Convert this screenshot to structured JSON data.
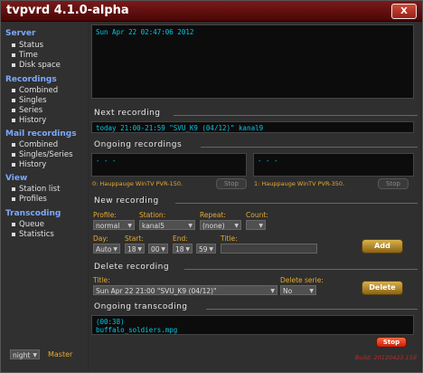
{
  "window": {
    "title": "tvpvrd 4.1.0-alpha",
    "close_label": "X"
  },
  "sidebar": {
    "sections": [
      {
        "title": "Server",
        "items": [
          "Status",
          "Time",
          "Disk space"
        ]
      },
      {
        "title": "Recordings",
        "items": [
          "Combined",
          "Singles",
          "Series",
          "History"
        ]
      },
      {
        "title": "Mail recordings",
        "items": [
          "Combined",
          "Singles/Series",
          "History"
        ]
      },
      {
        "title": "View",
        "items": [
          "Station list",
          "Profiles"
        ]
      },
      {
        "title": "Transcoding",
        "items": [
          "Queue",
          "Statistics"
        ]
      }
    ],
    "theme_select": "night",
    "master_label": "Master"
  },
  "status_panel": {
    "text": "Sun Apr 22 02:47:06 2012"
  },
  "next_recording": {
    "heading": "Next recording",
    "text": "today 21:00-21:59 \"SVU_K9 (04/12)\" kanal9"
  },
  "ongoing_recordings": {
    "heading": "Ongoing recordings",
    "tuners": [
      {
        "text": "- - -",
        "label": "0: Hauppauge WinTV PVR-150.",
        "stop_label": "Stop"
      },
      {
        "text": "- - -",
        "label": "1: Hauppauge WinTV PVR-350.",
        "stop_label": "Stop"
      }
    ]
  },
  "new_recording": {
    "heading": "New recording",
    "labels": {
      "profile": "Profile:",
      "station": "Station:",
      "repeat": "Repeat:",
      "count": "Count:",
      "day": "Day:",
      "start": "Start:",
      "end": "End:",
      "title": "Title:"
    },
    "values": {
      "profile": "normal",
      "station": "kanal5",
      "repeat": "(none)",
      "count": "",
      "day": "Auto",
      "start_h": "18",
      "start_m": "00",
      "end_h": "18",
      "end_m": "59",
      "title": ""
    },
    "add_label": "Add"
  },
  "delete_recording": {
    "heading": "Delete recording",
    "labels": {
      "title": "Title:",
      "delete_serie": "Delete serie:"
    },
    "values": {
      "title": "Sun Apr 22 21:00   \"SVU_K9 (04/12)\"",
      "delete_serie": "No"
    },
    "delete_label": "Delete"
  },
  "ongoing_transcoding": {
    "heading": "Ongoing transcoding",
    "line1": "(00:38)",
    "line2": "buffalo_soldiers.mpg",
    "stop_label": "Stop"
  },
  "build": {
    "text": "Build: 20120423.158"
  },
  "colors": {
    "accent_blue": "#7ba9ff",
    "label_orange": "#e6aa30",
    "panel_text": "#00c8e6",
    "title_red": "#7a1a1a"
  }
}
